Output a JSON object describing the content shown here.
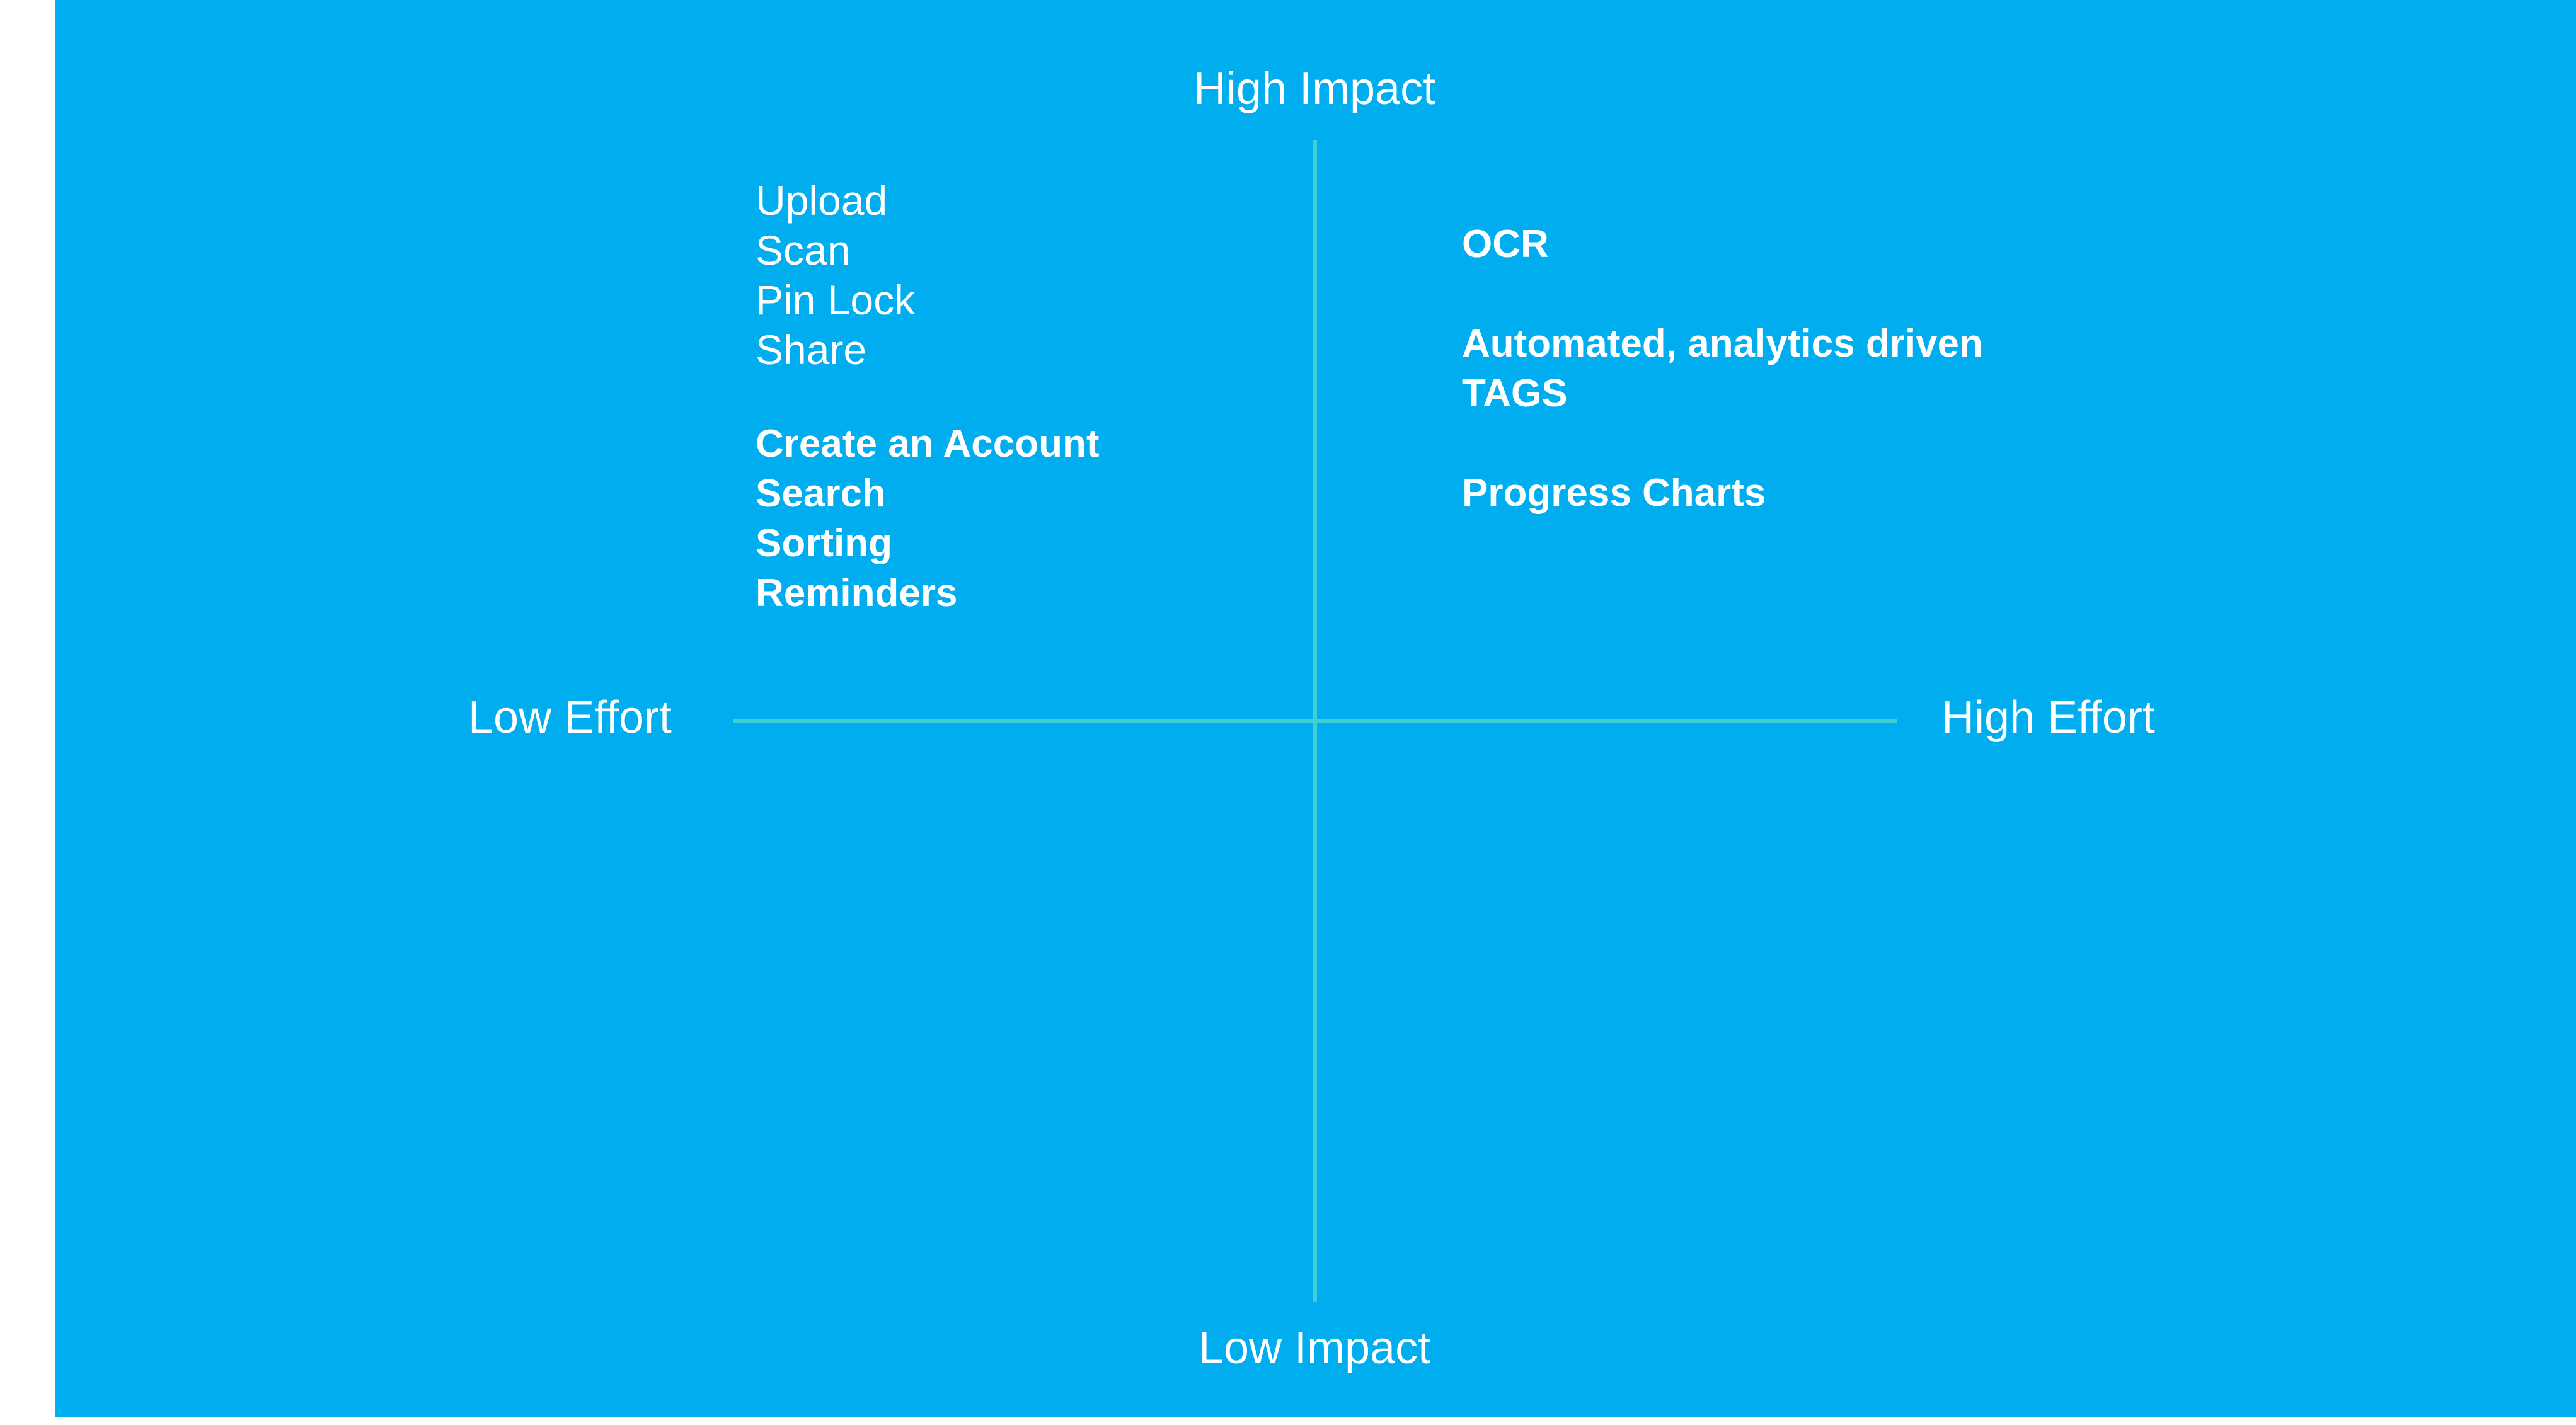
{
  "colors": {
    "background": "#00AEEF",
    "axis_line": "#3ECFD8",
    "text": "#FFFFFF"
  },
  "axes": {
    "top": "High Impact",
    "bottom": "Low Impact",
    "left": "Low Effort",
    "right": "High Effort"
  },
  "quadrants": {
    "high_impact_low_effort": {
      "regular_items": [
        "Upload",
        "Scan",
        "Pin Lock",
        "Share"
      ],
      "bold_items": [
        "Create an Account",
        "Search",
        "Sorting",
        "Reminders"
      ]
    },
    "high_impact_high_effort": {
      "items": [
        "OCR",
        "Automated, analytics driven",
        "TAGS",
        "Progress Charts"
      ]
    }
  }
}
